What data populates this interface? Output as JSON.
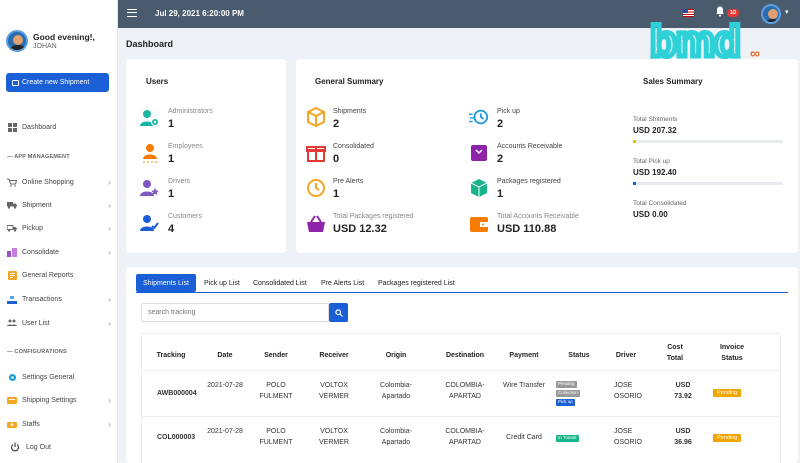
{
  "sidebar": {
    "greeting": "Good evening!,",
    "username": "JOHAN",
    "create_button": "Create new Shipment",
    "dashboard": "Dashboard",
    "section_app": "— APP MANAGEMENT",
    "items": [
      {
        "label": "Online Shopping",
        "icon": "cart-icon"
      },
      {
        "label": "Shipment",
        "icon": "truck-icon"
      },
      {
        "label": "Pickup",
        "icon": "pickup-truck-icon"
      },
      {
        "label": "Consolidate",
        "icon": "boxes-icon"
      },
      {
        "label": "General Reports",
        "icon": "report-icon"
      },
      {
        "label": "Transactions",
        "icon": "transactions-icon"
      },
      {
        "label": "User List",
        "icon": "users-icon"
      }
    ],
    "section_config": "— CONFIGURATIONS",
    "config_items": [
      {
        "label": "Settings General",
        "icon": "gear-icon"
      },
      {
        "label": "Shipping Settings",
        "icon": "shipping-settings-icon"
      },
      {
        "label": "Staffs",
        "icon": "staff-icon"
      },
      {
        "label": "Log Out",
        "icon": "power-icon"
      }
    ]
  },
  "topbar": {
    "datetime": "Jul 29, 2021 6:20:00 PM",
    "notification_count": "10",
    "flag": "us-flag-icon"
  },
  "logo_text": "bmd",
  "page_title": "Dashboard",
  "users_card": {
    "title": "Users",
    "stats": [
      {
        "label": "Administrators",
        "value": "1",
        "color": "#19b5a5"
      },
      {
        "label": "Employees",
        "value": "1",
        "color": "#f57c00"
      },
      {
        "label": "Drivers",
        "value": "1",
        "color": "#7e57c2"
      },
      {
        "label": "Customers",
        "value": "4",
        "color": "#1a5fd6"
      }
    ]
  },
  "general_summary": {
    "title": "General Summary",
    "left": [
      {
        "label": "Shipments",
        "value": "2",
        "color": "#f5a623"
      },
      {
        "label": "Consolidated",
        "value": "0",
        "color": "#e53935"
      },
      {
        "label": "Pre Alerts",
        "value": "1",
        "color": "#f5a623"
      },
      {
        "label": "Total Packages registered",
        "value": "USD 12.32",
        "color": "#8e24aa"
      }
    ],
    "right": [
      {
        "label": "Pick up",
        "value": "2",
        "color": "#1a9ad6"
      },
      {
        "label": "Accounts Receivable",
        "value": "2",
        "color": "#8e24aa"
      },
      {
        "label": "Packages registered",
        "value": "1",
        "color": "#19b58a"
      },
      {
        "label": "Total Accounts Receivable",
        "value": "USD 110.88",
        "color": "#f57c00"
      }
    ]
  },
  "sales_summary": {
    "title": "Sales Summary",
    "items": [
      {
        "label": "Total Shitments",
        "value": "USD 207.32",
        "fill": 0.02,
        "color": "#f5c000"
      },
      {
        "label": "Total Pick up",
        "value": "USD 192.40",
        "fill": 0.02,
        "color": "#1a5fd6"
      },
      {
        "label": "Total Consolidated",
        "value": "USD 0.00",
        "fill": 0,
        "color": "#1a5fd6"
      }
    ]
  },
  "tabs": [
    "Shipments List",
    "Pick up List",
    "Consolidated List",
    "Pre Alerts List",
    "Packages registered List"
  ],
  "search": {
    "placeholder": "search tracking"
  },
  "table": {
    "headers": [
      "Tracking",
      "Date",
      "Sender",
      "Receiver",
      "Origin",
      "Destination",
      "Payment",
      "Status",
      "Driver",
      "Cost Total",
      "Invoice Status"
    ],
    "rows": [
      {
        "tracking": "AWB000004",
        "date": "2021-07-28",
        "sender": "POLO FULMENT",
        "receiver": "VOLTOX VERMER",
        "origin": "Colombia-Apartado",
        "destination": "COLOMBIA-APARTAD",
        "payment": "Wire Transfer",
        "status": [
          "Pending",
          "Collection",
          "Pick up"
        ],
        "driver": "JOSE OSORIO",
        "cost": "USD 73.92",
        "invoice": "Pending"
      },
      {
        "tracking": "COL000003",
        "date": "2021-07-28",
        "sender": "POLO FULMENT",
        "receiver": "VOLTOX VERMER",
        "origin": "Colombia-Apartado",
        "destination": "COLOMBIA-APARTAD",
        "payment": "Credit Card",
        "status": [
          "In Transit"
        ],
        "driver": "JOSE OSORIO",
        "cost": "USD 36.96",
        "invoice": "Pending"
      }
    ]
  }
}
